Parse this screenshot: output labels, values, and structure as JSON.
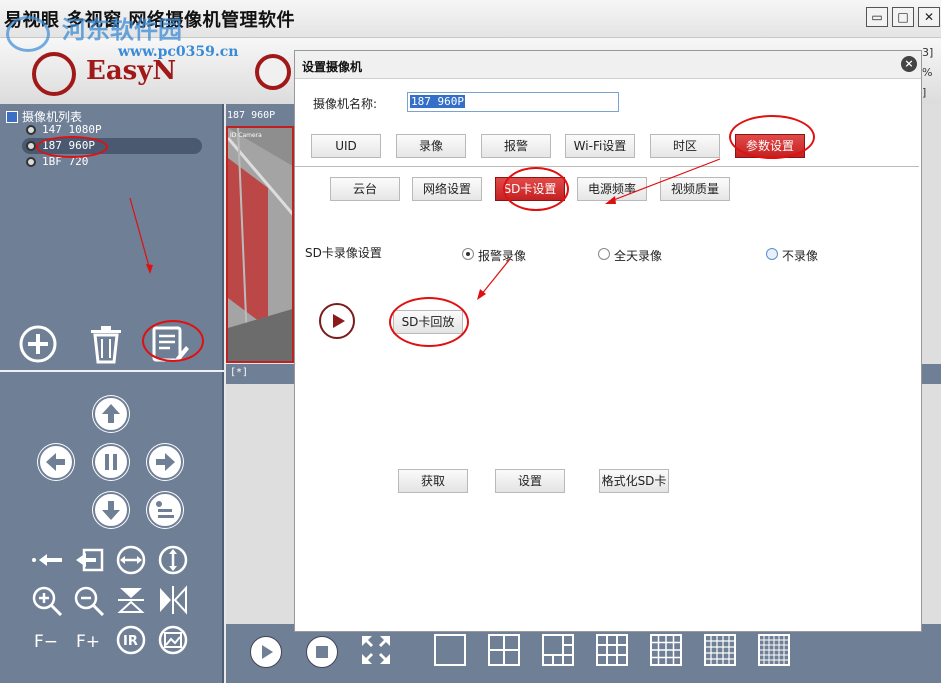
{
  "window": {
    "title": "易视眼 多视窗 网络摄像机管理软件",
    "minimize": "▭",
    "maximize": "□",
    "close": "✕"
  },
  "watermark": {
    "name": "河东软件园",
    "url": "www.pc0359.cn"
  },
  "brand": {
    "logo_text": "EasyN"
  },
  "right_edge": {
    "a": "3]",
    "b": "%",
    "c": "]"
  },
  "sidebar": {
    "title": "摄像机列表",
    "cameras": [
      {
        "label": "147 1080P"
      },
      {
        "label": "187 960P"
      },
      {
        "label": "1BF 720"
      }
    ]
  },
  "video": {
    "top_label": "187 960P",
    "cam_overlay": "ID Camera",
    "strip_label": "[*]"
  },
  "dialog": {
    "title": "设置摄像机",
    "close": "×",
    "name_label": "摄像机名称:",
    "name_value": "187 960P",
    "tabs_row1": [
      "UID",
      "录像",
      "报警",
      "Wi-Fi设置",
      "时区",
      "参数设置"
    ],
    "tabs_row2": [
      "云台",
      "网络设置",
      "SD卡设置",
      "电源频率",
      "视频质量"
    ],
    "sd_title": "SD卡录像设置",
    "radios": [
      {
        "label": "报警录像",
        "checked": true
      },
      {
        "label": "全天录像",
        "checked": false
      },
      {
        "label": "不录像",
        "checked": false
      }
    ],
    "playback_button": "SD卡回放",
    "get_button": "获取",
    "set_button": "设置",
    "format_button": "格式化SD卡"
  },
  "colors": {
    "sidebar_bg": "#6f7f96",
    "active_tab": "#c42121",
    "annotation": "#e01010"
  }
}
